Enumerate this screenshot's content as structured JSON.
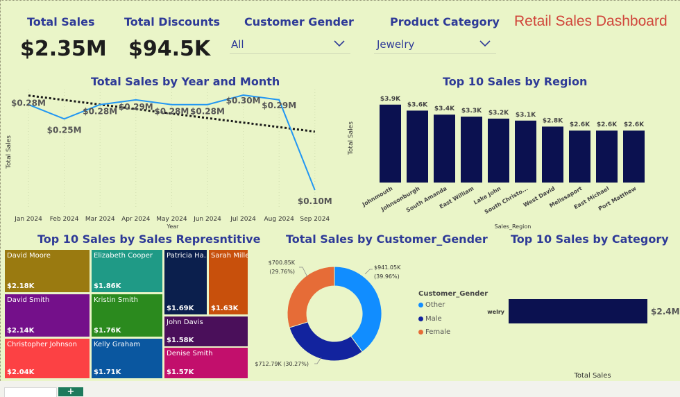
{
  "kpis": {
    "total_sales": {
      "label": "Total Sales",
      "value": "$2.35M"
    },
    "total_discounts": {
      "label": "Total Discounts",
      "value": "$94.5K"
    }
  },
  "slicers": {
    "gender": {
      "label": "Customer Gender",
      "value": "All"
    },
    "category": {
      "label": "Product Category",
      "value": "Jewelry"
    }
  },
  "dashboard_title": "Retail Sales Dashboard",
  "icons": {
    "dropdown": "chevron-down-icon",
    "add_page": "plus-icon"
  },
  "colors": {
    "title_blue": "#2e3a97",
    "line": "#2196f3",
    "bar_navy": "#0b1150",
    "donut_other": "#118dff",
    "donut_male": "#12239e",
    "donut_female": "#e66c37",
    "dashboard_title": "#d0453a"
  },
  "chart_data": [
    {
      "id": "sales_by_month",
      "type": "line",
      "title": "Total Sales by Year and Month",
      "xlabel": "Year",
      "ylabel": "Total Sales",
      "x": [
        "Jan 2024",
        "Feb 2024",
        "Mar 2024",
        "Apr 2024",
        "May 2024",
        "Jun 2024",
        "Jul 2024",
        "Aug 2024",
        "Sep 2024"
      ],
      "values": [
        0.28,
        0.25,
        0.28,
        0.29,
        0.28,
        0.28,
        0.3,
        0.29,
        0.1
      ],
      "labels": [
        "$0.28M",
        "$0.25M",
        "$0.28M",
        "$0.29M",
        "$0.28M",
        "$0.28M",
        "$0.30M",
        "$0.29M",
        "$0.10M"
      ],
      "trendline": true,
      "ylim": [
        0.1,
        0.3
      ]
    },
    {
      "id": "sales_by_region",
      "type": "bar",
      "title": "Top 10 Sales by Region",
      "xlabel": "Sales_Region",
      "ylabel": "Total Sales",
      "categories": [
        "Johnmouth",
        "Johnsonburgh",
        "South Amanda",
        "East William",
        "Lake John",
        "South Christo...",
        "West David",
        "Melissaport",
        "East Michael",
        "Port Matthew"
      ],
      "values": [
        3.9,
        3.6,
        3.4,
        3.3,
        3.2,
        3.1,
        2.8,
        2.6,
        2.6,
        2.6
      ],
      "labels": [
        "$3.9K",
        "$3.6K",
        "$3.4K",
        "$3.3K",
        "$3.2K",
        "$3.1K",
        "$2.8K",
        "$2.6K",
        "$2.6K",
        "$2.6K"
      ],
      "ylim": [
        0,
        4.1
      ]
    },
    {
      "id": "sales_by_rep",
      "type": "treemap",
      "title": "Top 10 Sales by Sales Represntitive",
      "items": [
        {
          "name": "David Moore",
          "value": "$2.18K",
          "color": "#9a7a10"
        },
        {
          "name": "David Smith",
          "value": "$2.14K",
          "color": "#74108a"
        },
        {
          "name": "Christopher Johnson",
          "value": "$2.04K",
          "color": "#fc4144"
        },
        {
          "name": "Elizabeth Cooper",
          "value": "$1.86K",
          "color": "#1f9a86"
        },
        {
          "name": "Kristin Smith",
          "value": "$1.76K",
          "color": "#2b8a1e"
        },
        {
          "name": "Kelly Graham",
          "value": "$1.71K",
          "color": "#0a57a0"
        },
        {
          "name": "Patricia Ha...",
          "value": "$1.69K",
          "color": "#0b1f4d"
        },
        {
          "name": "Sarah Miller",
          "value": "$1.63K",
          "color": "#c8500c"
        },
        {
          "name": "John Davis",
          "value": "$1.58K",
          "color": "#4a0f5a"
        },
        {
          "name": "Denise Smith",
          "value": "$1.57K",
          "color": "#c20f6c"
        }
      ]
    },
    {
      "id": "sales_by_gender",
      "type": "pie",
      "donut": true,
      "title": "Total Sales by Customer_Gender",
      "legend_title": "Customer_Gender",
      "slices": [
        {
          "name": "Other",
          "value": 941.05,
          "label": "$941.05K",
          "pct": "(39.96%)"
        },
        {
          "name": "Male",
          "value": 712.79,
          "label": "$712.79K (30.27%)",
          "pct": ""
        },
        {
          "name": "Female",
          "value": 700.85,
          "label": "$700.85K",
          "pct": "(29.76%)"
        }
      ]
    },
    {
      "id": "sales_by_category",
      "type": "bar",
      "orientation": "horizontal",
      "title": "Top 10 Sales by Category",
      "xlabel": "Total Sales",
      "categories": [
        "Jewelry"
      ],
      "category_labels": [
        "welry"
      ],
      "values": [
        2.4
      ],
      "labels": [
        "$2.4M"
      ]
    }
  ]
}
